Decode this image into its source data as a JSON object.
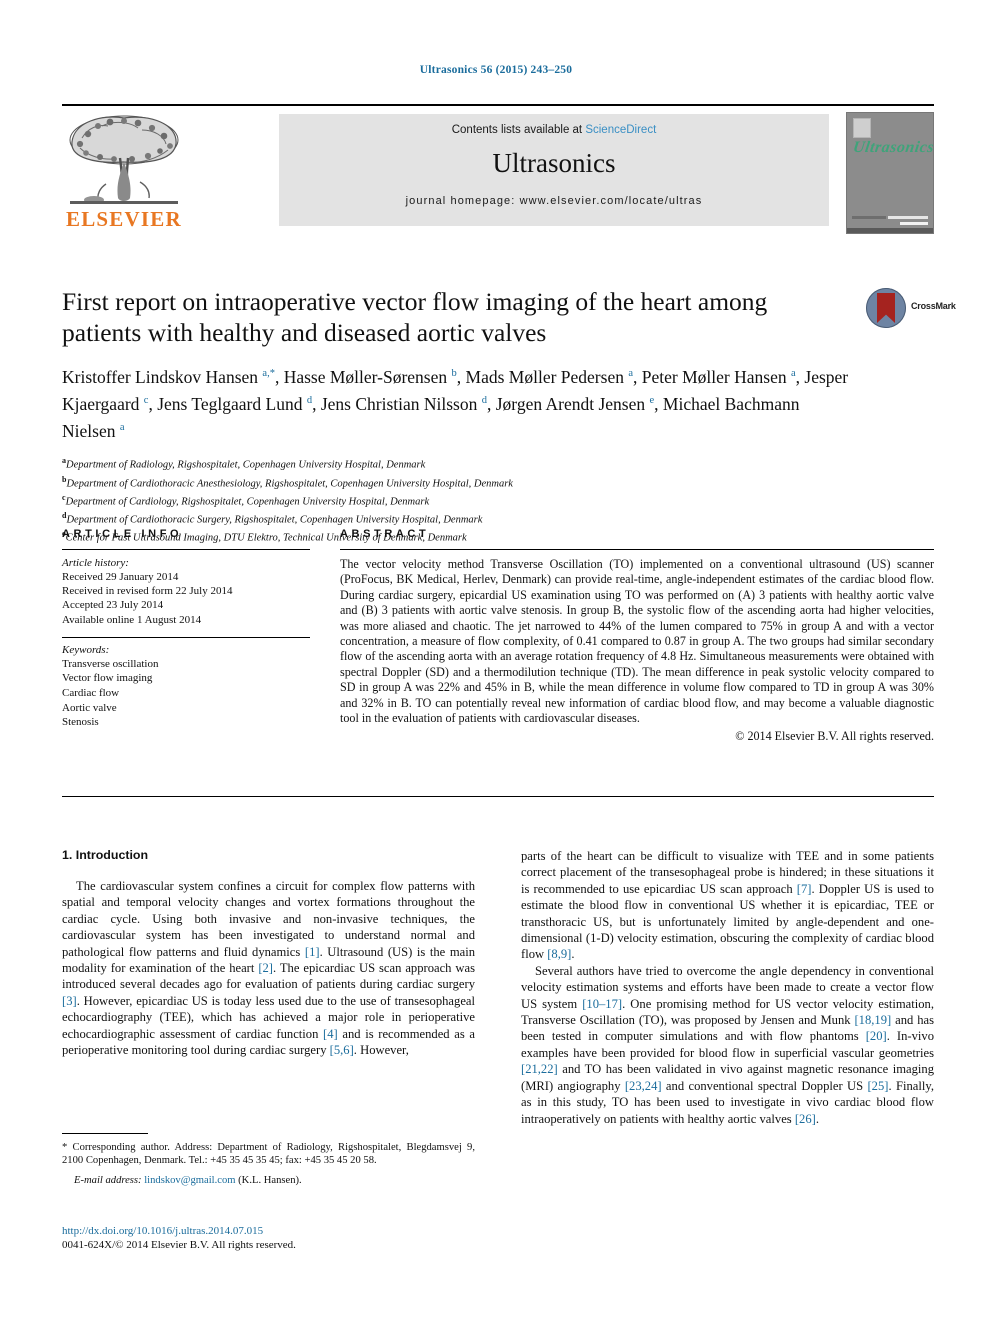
{
  "running_head": "Ultrasonics 56 (2015) 243–250",
  "masthead": {
    "publisher_logo_text": "ELSEVIER",
    "contents_prefix": "Contents lists available at ",
    "contents_link": "ScienceDirect",
    "journal_name": "Ultrasonics",
    "homepage": "journal homepage: www.elsevier.com/locate/ultras",
    "cover_title": "Ultrasonics"
  },
  "crossmark": {
    "label": "CrossMark"
  },
  "article": {
    "title": "First report on intraoperative vector flow imaging of the heart among patients with healthy and diseased aortic valves",
    "authors_html": "Kristoffer Lindskov Hansen <sup>a,*</sup>, Hasse Møller-Sørensen <sup>b</sup>, Mads Møller Pedersen <sup>a</sup>, Peter Møller Hansen <sup>a</sup>, Jesper Kjaergaard <sup>c</sup>, Jens Teglgaard Lund <sup>d</sup>, Jens Christian Nilsson <sup>d</sup>, Jørgen Arendt Jensen <sup>e</sup>, Michael Bachmann Nielsen <sup>a</sup>",
    "affiliations": [
      {
        "mark": "a",
        "text": "Department of Radiology, Rigshospitalet, Copenhagen University Hospital, Denmark"
      },
      {
        "mark": "b",
        "text": "Department of Cardiothoracic Anesthesiology, Rigshospitalet, Copenhagen University Hospital, Denmark"
      },
      {
        "mark": "c",
        "text": "Department of Cardiology, Rigshospitalet, Copenhagen University Hospital, Denmark"
      },
      {
        "mark": "d",
        "text": "Department of Cardiothoracic Surgery, Rigshospitalet, Copenhagen University Hospital, Denmark"
      },
      {
        "mark": "e",
        "text": "Center for Fast Ultrasound Imaging, DTU Elektro, Technical University of Denmark, Denmark"
      }
    ]
  },
  "article_info": {
    "heading": "ARTICLE INFO",
    "history_label": "Article history:",
    "history": [
      "Received 29 January 2014",
      "Received in revised form 22 July 2014",
      "Accepted 23 July 2014",
      "Available online 1 August 2014"
    ],
    "keywords_label": "Keywords:",
    "keywords": [
      "Transverse oscillation",
      "Vector flow imaging",
      "Cardiac flow",
      "Aortic valve",
      "Stenosis"
    ]
  },
  "abstract": {
    "heading": "ABSTRACT",
    "text": "The vector velocity method Transverse Oscillation (TO) implemented on a conventional ultrasound (US) scanner (ProFocus, BK Medical, Herlev, Denmark) can provide real-time, angle-independent estimates of the cardiac blood flow. During cardiac surgery, epicardial US examination using TO was performed on (A) 3 patients with healthy aortic valve and (B) 3 patients with aortic valve stenosis. In group B, the systolic flow of the ascending aorta had higher velocities, was more aliased and chaotic. The jet narrowed to 44% of the lumen compared to 75% in group A and with a vector concentration, a measure of flow complexity, of 0.41 compared to 0.87 in group A. The two groups had similar secondary flow of the ascending aorta with an average rotation frequency of 4.8 Hz. Simultaneous measurements were obtained with spectral Doppler (SD) and a thermodilution technique (TD). The mean difference in peak systolic velocity compared to SD in group A was 22% and 45% in B, while the mean difference in volume flow compared to TD in group A was 30% and 32% in B. TO can potentially reveal new information of cardiac blood flow, and may become a valuable diagnostic tool in the evaluation of patients with cardiovascular diseases.",
    "copyright": "© 2014 Elsevier B.V. All rights reserved."
  },
  "introduction": {
    "heading": "1. Introduction",
    "left_paragraph_html": "The cardiovascular system confines a circuit for complex flow patterns with spatial and temporal velocity changes and vortex formations throughout the cardiac cycle. Using both invasive and non-invasive techniques, the cardiovascular system has been investigated to understand normal and pathological flow patterns and fluid dynamics <span class=\"ref\">[1]</span>. Ultrasound (US) is the main modality for examination of the heart <span class=\"ref\">[2]</span>. The epicardiac US scan approach was introduced several decades ago for evaluation of patients during cardiac surgery <span class=\"ref\">[3]</span>. However, epicardiac US is today less used due to the use of transesophageal echocardiography (TEE), which has achieved a major role in perioperative echocardiographic assessment of cardiac function <span class=\"ref\">[4]</span> and is recommended as a perioperative monitoring tool during cardiac surgery <span class=\"ref\">[5,6]</span>. However,",
    "right_paragraph_1_html": "parts of the heart can be difficult to visualize with TEE and in some patients correct placement of the transesophageal probe is hindered; in these situations it is recommended to use epicardiac US scan approach <span class=\"ref\">[7]</span>. Doppler US is used to estimate the blood flow in conventional US whether it is epicardiac, TEE or transthoracic US, but is unfortunately limited by angle-dependent and one-dimensional (1-D) velocity estimation, obscuring the complexity of cardiac blood flow <span class=\"ref\">[8,9]</span>.",
    "right_paragraph_2_html": "Several authors have tried to overcome the angle dependency in conventional velocity estimation systems and efforts have been made to create a vector flow US system <span class=\"ref\">[10–17]</span>. One promising method for US vector velocity estimation, Transverse Oscillation (TO), was proposed by Jensen and Munk <span class=\"ref\">[18,19]</span> and has been tested in computer simulations and with flow phantoms <span class=\"ref\">[20]</span>. In-vivo examples have been provided for blood flow in superficial vascular geometries <span class=\"ref\">[21,22]</span> and TO has been validated in vivo against magnetic resonance imaging (MRI) angiography <span class=\"ref\">[23,24]</span> and conventional spectral Doppler US <span class=\"ref\">[25]</span>. Finally, as in this study, TO has been used to investigate in vivo cardiac blood flow intraoperatively on patients with healthy aortic valves <span class=\"ref\">[26]</span>."
  },
  "footnote": {
    "corresponding_html": "* Corresponding author. Address: Department of Radiology, Rigshospitalet, Blegdamsvej 9, 2100 Copenhagen, Denmark. Tel.: +45 35 45 35 45; fax: +45 35 45 20 58.",
    "email_label": "E-mail address:",
    "email": "lindskov@gmail.com",
    "email_owner": "(K.L. Hansen).",
    "doi": "http://dx.doi.org/10.1016/j.ultras.2014.07.015",
    "issn_line": "0041-624X/© 2014 Elsevier B.V. All rights reserved."
  },
  "colors": {
    "link_blue": "#1a6c9c",
    "sciencedirect_blue": "#3a8fc4",
    "elsevier_orange": "#E87722",
    "cover_green": "#3fa37a",
    "masthead_gray": "#e3e3e3"
  }
}
